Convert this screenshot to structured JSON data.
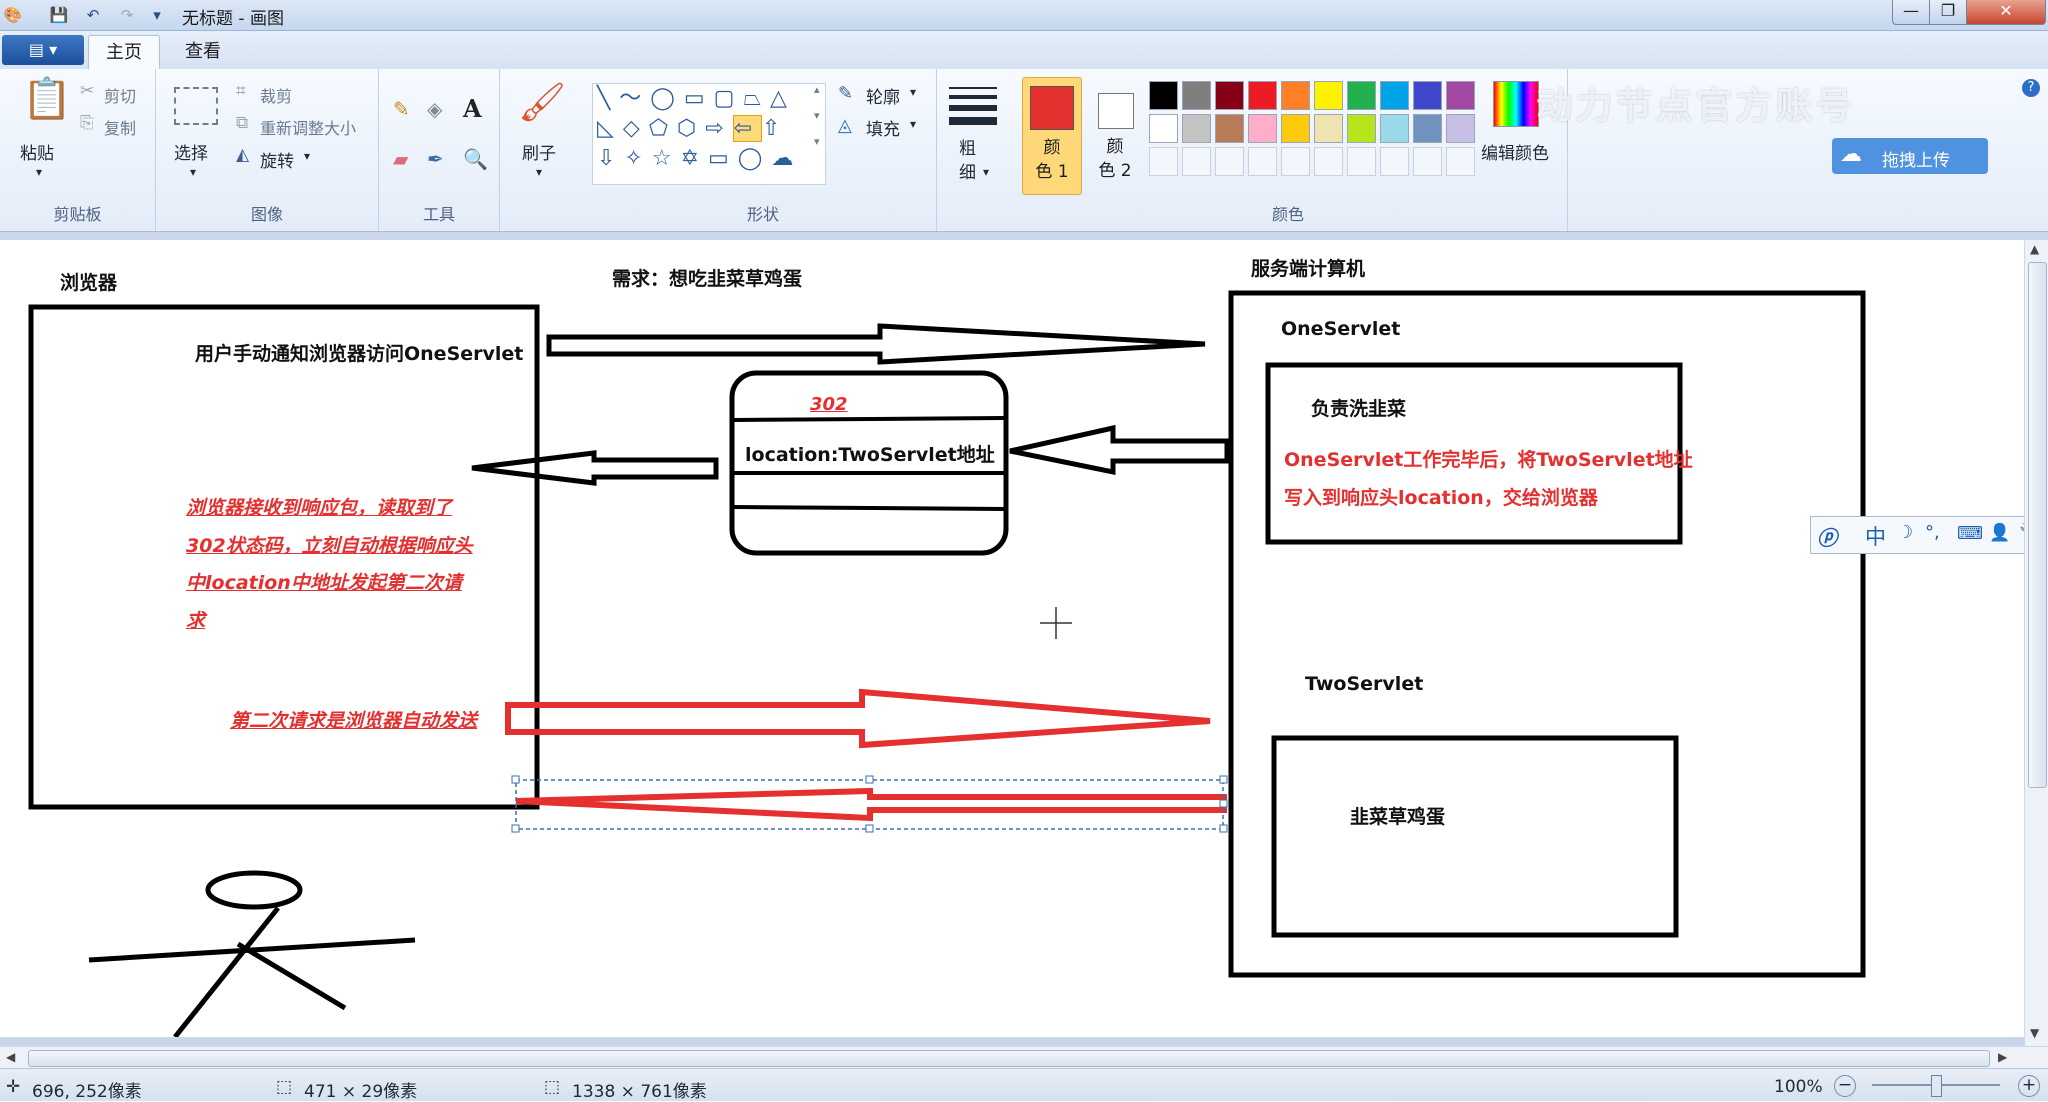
{
  "window": {
    "title": "无标题 - 画图",
    "min_icon": "—",
    "max_icon": "❐",
    "close_icon": "✕"
  },
  "tabs": {
    "file": "▤ ▾",
    "home": "主页",
    "view": "查看"
  },
  "ribbon": {
    "clipboard": {
      "paste": "粘贴",
      "cut": "剪切",
      "copy": "复制",
      "group": "剪贴板"
    },
    "image": {
      "select": "选择",
      "crop": "裁剪",
      "resize": "重新调整大小",
      "rotate": "旋转",
      "group": "图像"
    },
    "tools": {
      "group": "工具",
      "text_glyph": "A"
    },
    "brush": {
      "label": "刷子"
    },
    "shapes": {
      "outline": "轮廓",
      "fill": "填充",
      "group": "形状"
    },
    "size": {
      "label": "粗\n细"
    },
    "color1": {
      "label": "颜\n色 1",
      "value": "#e53030"
    },
    "color2": {
      "label": "颜\n色 2",
      "value": "#ffffff"
    },
    "colors": {
      "group": "颜色",
      "edit": "编辑颜色"
    },
    "palette_row1": [
      "#000000",
      "#7f7f7f",
      "#880015",
      "#ed1c24",
      "#ff7f27",
      "#fff200",
      "#22b14c",
      "#00a2e8",
      "#3f48cc",
      "#a349a4"
    ],
    "palette_row2": [
      "#ffffff",
      "#c3c3c3",
      "#b97a57",
      "#ffaec9",
      "#ffc90e",
      "#efe4b0",
      "#b5e61d",
      "#99d9ea",
      "#7092be",
      "#c8bfe7"
    ],
    "watermark": "动力节点官方账号",
    "upload": "拖拽上传"
  },
  "ime": {
    "lang": "中"
  },
  "drawing": {
    "browser_title": "浏览器",
    "requirement": "需求：想吃韭菜草鸡蛋",
    "server_title": "服务端计算机",
    "user_notify": "用户手动通知浏览器访问OneServlet",
    "status_code": "302",
    "location": "location:TwoServlet地址",
    "one_servlet": "OneServlet",
    "wash": "负责洗韭菜",
    "one_note_line1": "OneServlet工作完毕后，将TwoServlet地址",
    "one_note_line2": "写入到响应头location，交给浏览器",
    "browser_note": [
      "浏览器接收到响应包，读取到了",
      "302状态码，立刻自动根据响应头",
      "中location中地址发起第二次请",
      "求"
    ],
    "second_request": "第二次请求是浏览器自动发送",
    "two_servlet": "TwoServlet",
    "egg": "韭菜草鸡蛋"
  },
  "status": {
    "cursor": "696, 252像素",
    "selection": "471 × 29像素",
    "canvas_size": "1338 × 761像素",
    "zoom": "100%",
    "zoom_level": 0.5
  }
}
